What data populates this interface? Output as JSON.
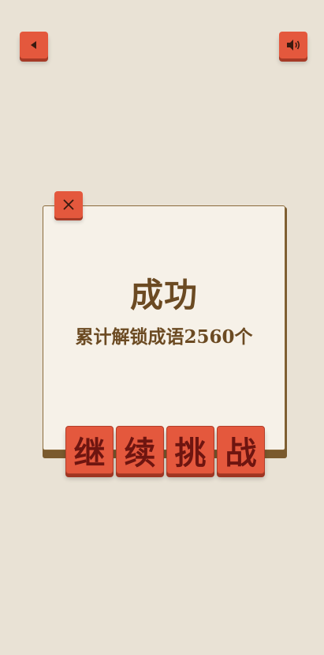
{
  "header": {
    "back_icon": "triangle-left-icon",
    "sound_icon": "speaker-icon"
  },
  "dialog": {
    "close_icon": "close-x-icon",
    "title": "成功",
    "message": "累计解锁成语2560个"
  },
  "action_tiles": [
    "继",
    "续",
    "挑",
    "战"
  ],
  "colors": {
    "background": "#e9e2d5",
    "button_red": "#e4583d",
    "dialog_bg": "#f6f1e8",
    "text_brown": "#6b4a22",
    "tile_text": "#6e1510"
  }
}
